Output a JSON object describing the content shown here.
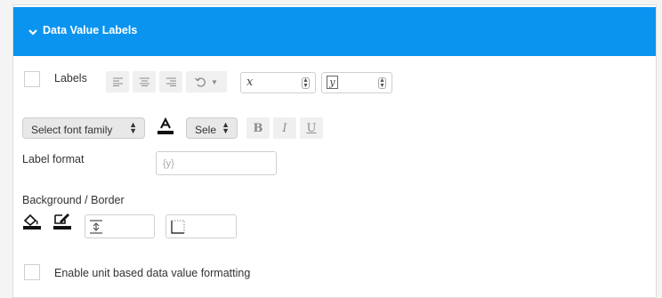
{
  "section": {
    "title": "Data Value Labels",
    "icon": "chevron-down-icon"
  },
  "labels_row": {
    "checkbox_checked": false,
    "label": "Labels",
    "align_icons": [
      "align-left-icon",
      "align-center-icon",
      "align-right-icon"
    ],
    "rotate_icon": "rotate-icon",
    "x_offset_icon": "x-offset-icon",
    "y_offset_icon": "y-offset-icon",
    "x_glyph": "x",
    "y_glyph": "y"
  },
  "font_row": {
    "font_family_value": "Select font family",
    "font_size_value": "Select",
    "font_color_icon": "text-color-icon",
    "bold": "B",
    "italic": "I",
    "underline": "U"
  },
  "label_format": {
    "label": "Label format",
    "placeholder": "{y}"
  },
  "background_border": {
    "label": "Background / Border",
    "fill_icon": "fill-color-icon",
    "border_color_icon": "border-color-icon",
    "padding_icon": "padding-icon",
    "border_icon": "border-style-icon"
  },
  "unit_formatting": {
    "checkbox_checked": false,
    "label": "Enable unit based data value formatting"
  },
  "colors": {
    "accent": "#0a94f0"
  }
}
